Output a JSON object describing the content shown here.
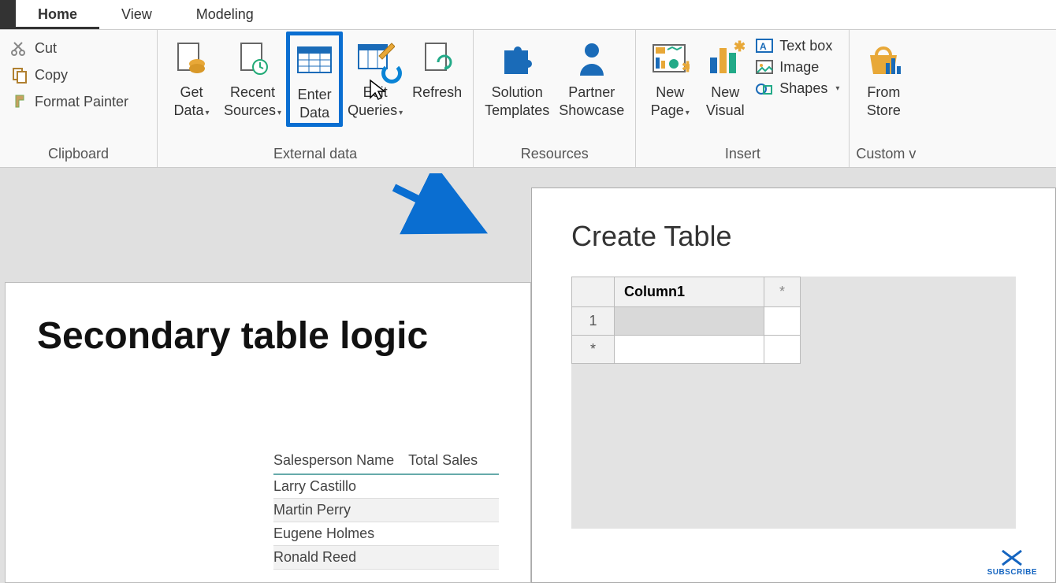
{
  "tabs": {
    "home": "Home",
    "view": "View",
    "modeling": "Modeling"
  },
  "clipboard": {
    "cut": "Cut",
    "copy": "Copy",
    "format": "Format Painter",
    "group": "Clipboard"
  },
  "external": {
    "get_data": "Get\nData",
    "recent": "Recent\nSources",
    "enter": "Enter\nData",
    "edit": "Edit\nQueries",
    "refresh": "Refresh",
    "group": "External data"
  },
  "resources": {
    "solution": "Solution\nTemplates",
    "partner": "Partner\nShowcase",
    "group": "Resources"
  },
  "insert": {
    "new_page": "New\nPage",
    "new_visual": "New\nVisual",
    "textbox": "Text box",
    "image": "Image",
    "shapes": "Shapes",
    "group": "Insert"
  },
  "custom": {
    "from_store": "From\nStore",
    "group": "Custom v"
  },
  "report": {
    "title": "Secondary table logic",
    "headers": {
      "name": "Salesperson Name",
      "sales": "Total Sales"
    },
    "rows": [
      "Larry Castillo",
      "Martin Perry",
      "Eugene Holmes",
      "Ronald Reed"
    ]
  },
  "dialog": {
    "title": "Create Table",
    "col1": "Column1",
    "asterisk": "*",
    "row1": "1"
  },
  "subscribe": "SUBSCRIBE",
  "caret": "▾"
}
